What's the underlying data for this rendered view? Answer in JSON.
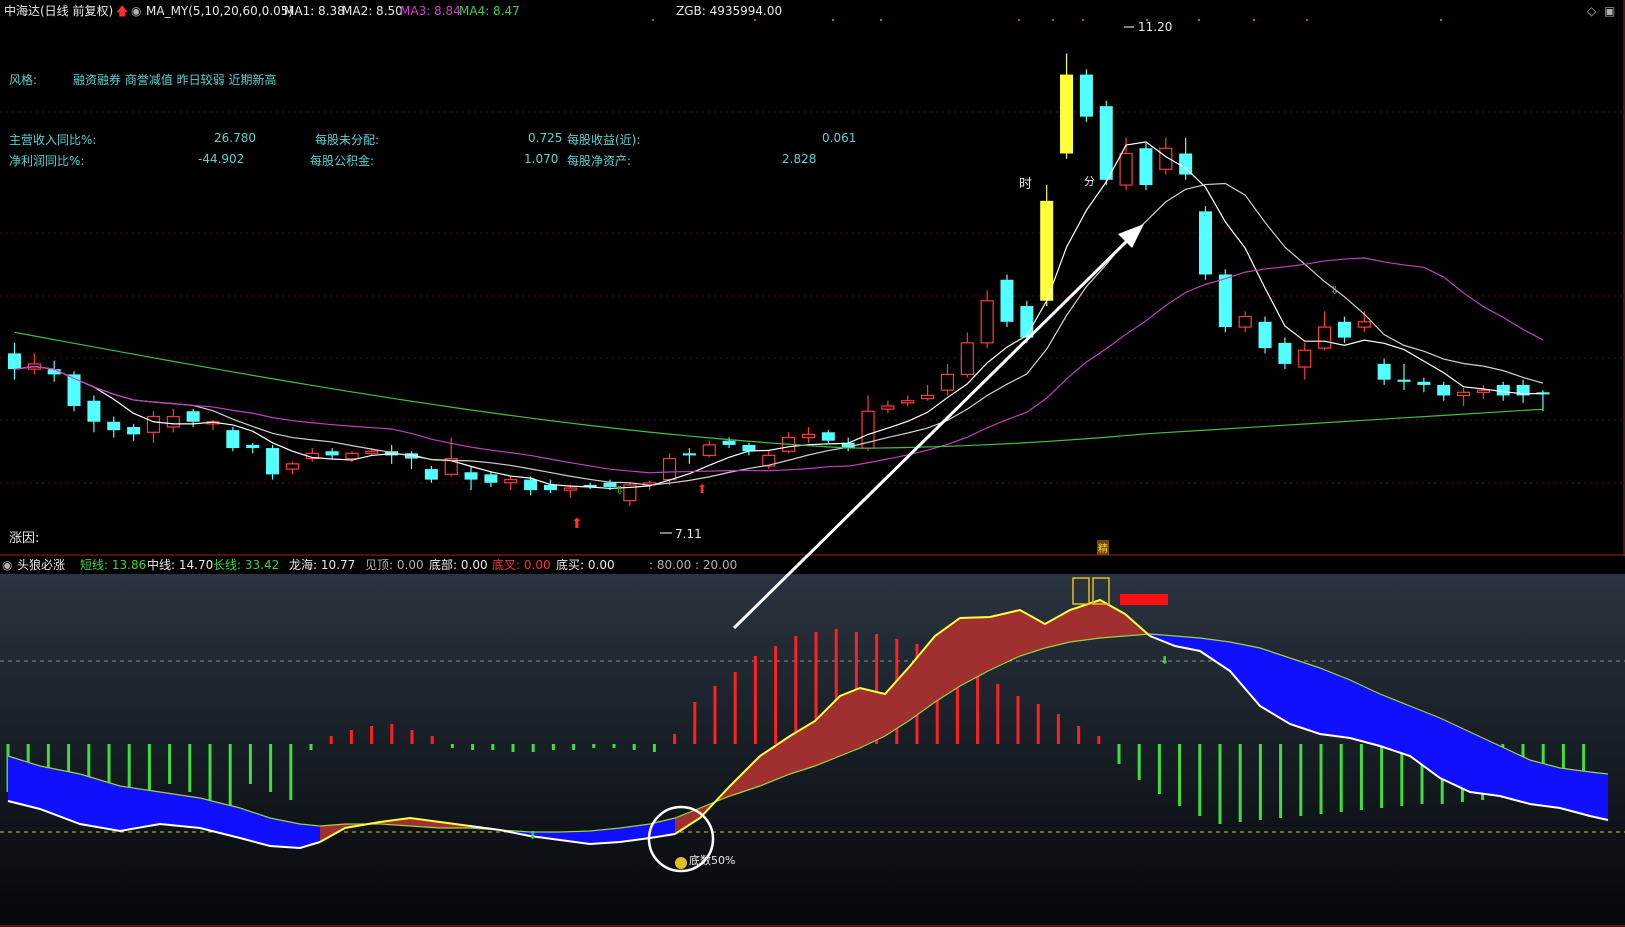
{
  "header": {
    "stock": "中海达(日线 前复权)",
    "indicator": "MA_MY(5,10,20,60,0.05)",
    "ma1": "MA1: 8.38",
    "ma2": "MA2: 8.50",
    "ma3": "MA3: 8.84",
    "ma4": "MA4: 8.47",
    "zgb": "ZGB: 4935994.00"
  },
  "info": {
    "style_label": "风格:",
    "style_value": "融资融券 商誉减值 昨日较弱 近期新高",
    "rows": [
      {
        "l1": "主营收入同比%:",
        "v1": "26.780",
        "l2": "每股未分配:",
        "v2": "0.725",
        "l3": "每股收益(近):",
        "v3": "0.061"
      },
      {
        "l1": "净利润同比%:",
        "v1": "-44.902",
        "l2": "每股公积金:",
        "v2": "1.070",
        "l3": "每股净资产:",
        "v3": "2.828"
      }
    ],
    "reason_label": "涨因:"
  },
  "annotations": {
    "high": "11.20",
    "low": "7.11",
    "shi": "时",
    "fen": "分",
    "jing": "精",
    "lower_marker": "底数50%"
  },
  "lower": {
    "name": "头狼必涨",
    "short": {
      "label": "短线:",
      "value": "13.86"
    },
    "mid": {
      "label": "中线:",
      "value": "14.70"
    },
    "long": {
      "label": "长线:",
      "value": "33.42"
    },
    "dragon": {
      "label": "龙海:",
      "value": "10.77"
    },
    "top": {
      "label": "见顶:",
      "value": "0.00"
    },
    "bottom": {
      "label": "底部:",
      "value": "0.00"
    },
    "cross": {
      "label": "底叉:",
      "value": "0.00"
    },
    "buy": {
      "label": "底买:",
      "value": "0.00"
    },
    "levels": ": 80.00 : 20.00"
  },
  "colors": {
    "up": "#ff3b3b",
    "down": "#54ffff",
    "yellow": "#ffff3a",
    "ma1": "#ffffff",
    "ma2": "#d0d0d0",
    "ma3": "#c040c0",
    "ma4": "#40c040",
    "blue_fill": "#1010ff",
    "red_fill": "#a03030",
    "yellow_line": "#ffff40"
  },
  "chart_data": {
    "type": "candlestick",
    "title": "中海达(日线 前复权)",
    "ylim": [
      6.5,
      11.5
    ],
    "candles": [
      {
        "o": 8.35,
        "c": 8.2,
        "h": 8.45,
        "l": 8.1
      },
      {
        "o": 8.2,
        "c": 8.25,
        "h": 8.35,
        "l": 8.15
      },
      {
        "o": 8.2,
        "c": 8.15,
        "h": 8.28,
        "l": 8.08
      },
      {
        "o": 8.15,
        "c": 7.85,
        "h": 8.18,
        "l": 7.8
      },
      {
        "o": 7.9,
        "c": 7.7,
        "h": 7.95,
        "l": 7.6
      },
      {
        "o": 7.7,
        "c": 7.62,
        "h": 7.75,
        "l": 7.55
      },
      {
        "o": 7.65,
        "c": 7.58,
        "h": 7.68,
        "l": 7.52
      },
      {
        "o": 7.6,
        "c": 7.75,
        "h": 7.8,
        "l": 7.5
      },
      {
        "o": 7.65,
        "c": 7.75,
        "h": 7.82,
        "l": 7.6
      },
      {
        "o": 7.8,
        "c": 7.7,
        "h": 7.82,
        "l": 7.65
      },
      {
        "o": 7.68,
        "c": 7.7,
        "h": 7.72,
        "l": 7.62
      },
      {
        "o": 7.62,
        "c": 7.45,
        "h": 7.65,
        "l": 7.42
      },
      {
        "o": 7.48,
        "c": 7.45,
        "h": 7.5,
        "l": 7.4
      },
      {
        "o": 7.45,
        "c": 7.2,
        "h": 7.48,
        "l": 7.15
      },
      {
        "o": 7.25,
        "c": 7.3,
        "h": 7.32,
        "l": 7.2
      },
      {
        "o": 7.35,
        "c": 7.4,
        "h": 7.45,
        "l": 7.32
      },
      {
        "o": 7.42,
        "c": 7.38,
        "h": 7.45,
        "l": 7.35
      },
      {
        "o": 7.35,
        "c": 7.4,
        "h": 7.42,
        "l": 7.32
      },
      {
        "o": 7.4,
        "c": 7.42,
        "h": 7.45,
        "l": 7.38
      },
      {
        "o": 7.42,
        "c": 7.38,
        "h": 7.48,
        "l": 7.3
      },
      {
        "o": 7.4,
        "c": 7.35,
        "h": 7.42,
        "l": 7.25
      },
      {
        "o": 7.25,
        "c": 7.15,
        "h": 7.28,
        "l": 7.12
      },
      {
        "o": 7.2,
        "c": 7.35,
        "h": 7.55,
        "l": 7.18
      },
      {
        "o": 7.22,
        "c": 7.15,
        "h": 7.28,
        "l": 7.05
      },
      {
        "o": 7.2,
        "c": 7.12,
        "h": 7.22,
        "l": 7.08
      },
      {
        "o": 7.12,
        "c": 7.15,
        "h": 7.18,
        "l": 7.05
      },
      {
        "o": 7.15,
        "c": 7.05,
        "h": 7.18,
        "l": 7.0
      },
      {
        "o": 7.1,
        "c": 7.05,
        "h": 7.15,
        "l": 7.02
      },
      {
        "o": 7.05,
        "c": 7.07,
        "h": 7.1,
        "l": 6.98
      },
      {
        "o": 7.1,
        "c": 7.08,
        "h": 7.12,
        "l": 7.06
      },
      {
        "o": 7.12,
        "c": 7.08,
        "h": 7.15,
        "l": 7.05
      },
      {
        "o": 6.95,
        "c": 7.1,
        "h": 7.12,
        "l": 6.9
      },
      {
        "o": 7.1,
        "c": 7.12,
        "h": 7.14,
        "l": 7.05
      },
      {
        "o": 7.15,
        "c": 7.35,
        "h": 7.4,
        "l": 7.1
      },
      {
        "o": 7.4,
        "c": 7.38,
        "h": 7.45,
        "l": 7.3
      },
      {
        "o": 7.38,
        "c": 7.48,
        "h": 7.52,
        "l": 7.36
      },
      {
        "o": 7.52,
        "c": 7.48,
        "h": 7.55,
        "l": 7.45
      },
      {
        "o": 7.48,
        "c": 7.42,
        "h": 7.5,
        "l": 7.38
      },
      {
        "o": 7.28,
        "c": 7.38,
        "h": 7.42,
        "l": 7.25
      },
      {
        "o": 7.42,
        "c": 7.55,
        "h": 7.6,
        "l": 7.4
      },
      {
        "o": 7.55,
        "c": 7.58,
        "h": 7.65,
        "l": 7.5
      },
      {
        "o": 7.6,
        "c": 7.52,
        "h": 7.62,
        "l": 7.5
      },
      {
        "o": 7.5,
        "c": 7.45,
        "h": 7.55,
        "l": 7.42
      },
      {
        "o": 7.45,
        "c": 7.8,
        "h": 7.95,
        "l": 7.42
      },
      {
        "o": 7.82,
        "c": 7.85,
        "h": 7.9,
        "l": 7.78
      },
      {
        "o": 7.88,
        "c": 7.9,
        "h": 7.95,
        "l": 7.85
      },
      {
        "o": 7.92,
        "c": 7.95,
        "h": 8.05,
        "l": 7.9
      },
      {
        "o": 8.0,
        "c": 8.15,
        "h": 8.25,
        "l": 7.95
      },
      {
        "o": 8.15,
        "c": 8.45,
        "h": 8.55,
        "l": 8.12
      },
      {
        "o": 8.45,
        "c": 8.85,
        "h": 8.95,
        "l": 8.4
      },
      {
        "o": 9.05,
        "c": 8.65,
        "h": 9.1,
        "l": 8.6
      },
      {
        "o": 8.8,
        "c": 8.5,
        "h": 8.85,
        "l": 8.45
      },
      {
        "o": 8.85,
        "c": 9.8,
        "h": 9.95,
        "l": 8.8,
        "y": 1
      },
      {
        "o": 10.25,
        "c": 11.0,
        "h": 11.2,
        "l": 10.2,
        "y": 1
      },
      {
        "o": 11.0,
        "c": 10.6,
        "h": 11.05,
        "l": 10.55
      },
      {
        "o": 10.7,
        "c": 10.0,
        "h": 10.75,
        "l": 9.95
      },
      {
        "o": 9.95,
        "c": 10.25,
        "h": 10.4,
        "l": 9.9
      },
      {
        "o": 10.3,
        "c": 9.95,
        "h": 10.35,
        "l": 9.9
      },
      {
        "o": 10.1,
        "c": 10.3,
        "h": 10.4,
        "l": 10.05
      },
      {
        "o": 10.25,
        "c": 10.05,
        "h": 10.4,
        "l": 10.0
      },
      {
        "o": 9.7,
        "c": 9.1,
        "h": 9.75,
        "l": 9.05
      },
      {
        "o": 9.1,
        "c": 8.6,
        "h": 9.15,
        "l": 8.55
      },
      {
        "o": 8.6,
        "c": 8.7,
        "h": 8.75,
        "l": 8.55
      },
      {
        "o": 8.65,
        "c": 8.4,
        "h": 8.7,
        "l": 8.35
      },
      {
        "o": 8.45,
        "c": 8.25,
        "h": 8.5,
        "l": 8.2
      },
      {
        "o": 8.22,
        "c": 8.38,
        "h": 8.45,
        "l": 8.1
      },
      {
        "o": 8.4,
        "c": 8.6,
        "h": 8.75,
        "l": 8.38
      },
      {
        "o": 8.65,
        "c": 8.5,
        "h": 8.7,
        "l": 8.45
      },
      {
        "o": 8.6,
        "c": 8.65,
        "h": 8.75,
        "l": 8.55
      },
      {
        "o": 8.25,
        "c": 8.1,
        "h": 8.3,
        "l": 8.05
      },
      {
        "o": 8.1,
        "c": 8.08,
        "h": 8.25,
        "l": 8.0
      },
      {
        "o": 8.08,
        "c": 8.05,
        "h": 8.12,
        "l": 7.98
      },
      {
        "o": 8.05,
        "c": 7.95,
        "h": 8.08,
        "l": 7.9
      },
      {
        "o": 7.95,
        "c": 7.98,
        "h": 8.02,
        "l": 7.85
      },
      {
        "o": 7.98,
        "c": 8.0,
        "h": 8.05,
        "l": 7.92
      },
      {
        "o": 8.05,
        "c": 7.95,
        "h": 8.08,
        "l": 7.9
      },
      {
        "o": 8.05,
        "c": 7.95,
        "h": 8.1,
        "l": 7.88
      },
      {
        "o": 7.98,
        "c": 7.96,
        "h": 8.0,
        "l": 7.8
      }
    ]
  }
}
